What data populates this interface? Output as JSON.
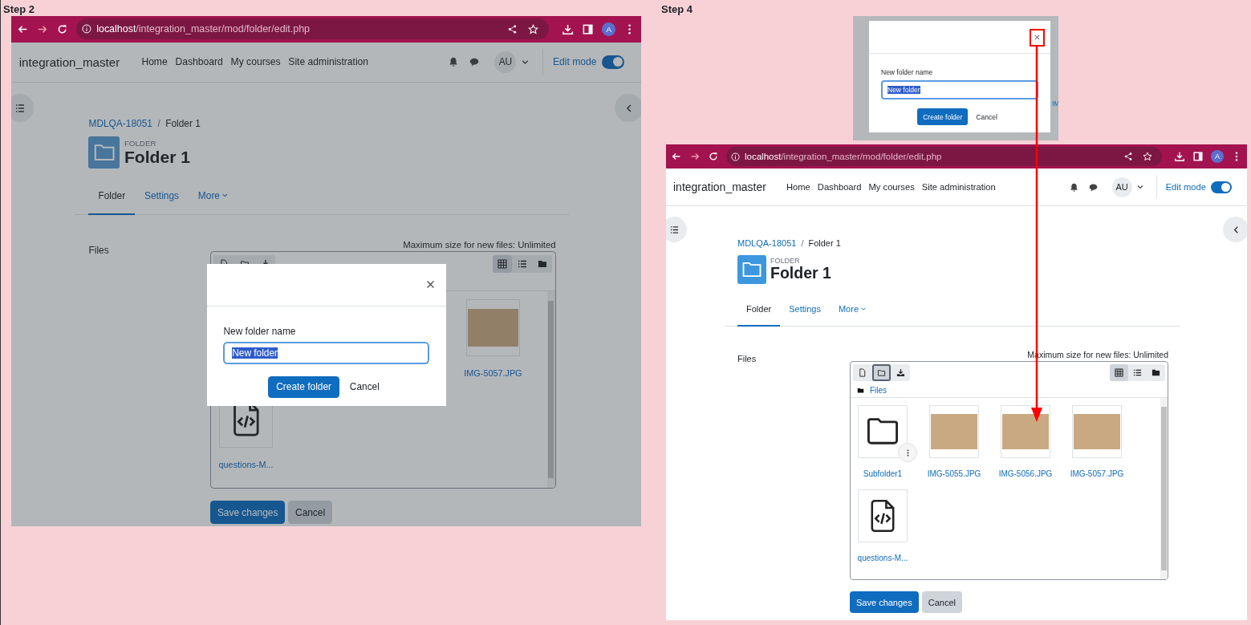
{
  "steps": [
    {
      "label": "Step 2",
      "browser": {
        "host": "localhost",
        "path": "/integration_master/mod/folder/edit.php",
        "profile": "A"
      },
      "navbar": {
        "site": "integration_master",
        "links": [
          "Home",
          "Dashboard",
          "My courses",
          "Site administration"
        ],
        "user": "AU",
        "edit_mode": {
          "label": "Edit mode",
          "on": true
        }
      },
      "breadcrumb": {
        "items": [
          "MDLQA-18051",
          "Folder 1"
        ],
        "separator": "/"
      },
      "header": {
        "kicker": "FOLDER",
        "title": "Folder 1"
      },
      "tabs": [
        {
          "label": "Folder",
          "selected": true,
          "dropdown": false
        },
        {
          "label": "Settings",
          "selected": false,
          "dropdown": false
        },
        {
          "label": "More",
          "selected": false,
          "dropdown": true
        }
      ],
      "files": {
        "label": "Files",
        "max_size": "Maximum size for new files: Unlimited",
        "toolbar": [
          {
            "kind": "file",
            "selected": false
          },
          {
            "kind": "folder",
            "selected": false
          },
          {
            "kind": "download",
            "selected": false
          }
        ],
        "views": [
          {
            "kind": "grid",
            "selected": true
          },
          {
            "kind": "list",
            "selected": false
          },
          {
            "kind": "tree",
            "selected": false
          }
        ],
        "rows": [
          [
            {
              "name": "IMG-5057.JPG",
              "kind": "image"
            }
          ],
          [
            {
              "name": "questions-M...",
              "kind": "code"
            }
          ]
        ]
      },
      "buttons": [
        "Save changes",
        "Cancel"
      ],
      "dialog": {
        "label": "New folder name",
        "value": "New folder",
        "value_selected": true,
        "buttons": [
          "Create folder",
          "Cancel"
        ]
      }
    },
    {
      "label": "Step 4",
      "inset": {
        "dialog": {
          "label": "New folder name",
          "value": "New folder",
          "value_selected": true,
          "buttons": [
            "Create folder",
            "Cancel"
          ]
        },
        "partial_text": "IM"
      },
      "browser": {
        "host": "localhost",
        "path": "/integration_master/mod/folder/edit.php",
        "profile": "A"
      },
      "navbar": {
        "site": "integration_master",
        "links": [
          "Home",
          "Dashboard",
          "My courses",
          "Site administration"
        ],
        "user": "AU",
        "edit_mode": {
          "label": "Edit mode",
          "on": true
        }
      },
      "breadcrumb": {
        "items": [
          "MDLQA-18051",
          "Folder 1"
        ],
        "separator": "/"
      },
      "header": {
        "kicker": "FOLDER",
        "title": "Folder 1"
      },
      "tabs": [
        {
          "label": "Folder",
          "selected": true,
          "dropdown": false
        },
        {
          "label": "Settings",
          "selected": false,
          "dropdown": false
        },
        {
          "label": "More",
          "selected": false,
          "dropdown": true
        }
      ],
      "files": {
        "label": "Files",
        "max_size": "Maximum size for new files: Unlimited",
        "path": "Files",
        "toolbar": [
          {
            "kind": "file",
            "selected": false
          },
          {
            "kind": "folder",
            "selected": true
          },
          {
            "kind": "download",
            "selected": false
          }
        ],
        "views": [
          {
            "kind": "grid",
            "selected": true
          },
          {
            "kind": "list",
            "selected": false
          },
          {
            "kind": "tree",
            "selected": false
          }
        ],
        "rows": [
          [
            {
              "name": "Subfolder1",
              "kind": "folder"
            },
            {
              "name": "IMG-5055.JPG",
              "kind": "image"
            },
            {
              "name": "IMG-5056.JPG",
              "kind": "image"
            },
            {
              "name": "IMG-5057.JPG",
              "kind": "image"
            }
          ],
          [
            {
              "name": "questions-M...",
              "kind": "code"
            }
          ]
        ]
      },
      "buttons": [
        "Save changes",
        "Cancel"
      ]
    }
  ]
}
